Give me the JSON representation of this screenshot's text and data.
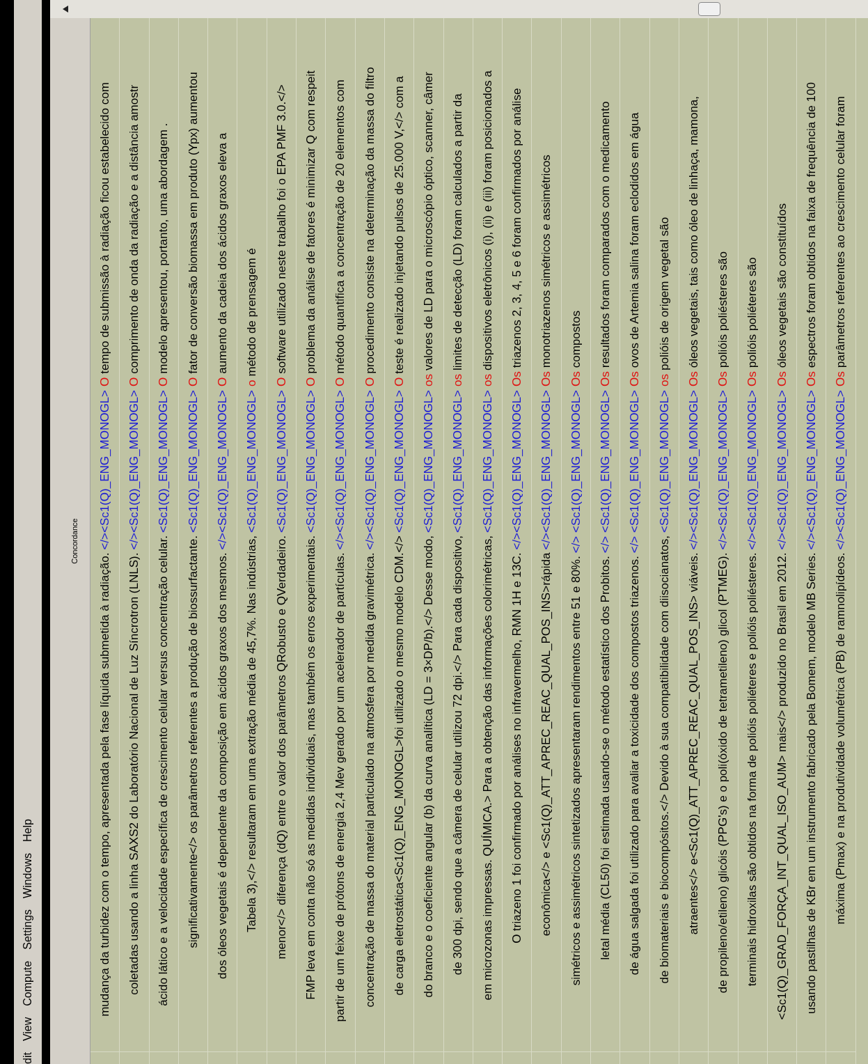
{
  "menu": [
    {
      "label": "dit"
    },
    {
      "label": "View"
    },
    {
      "label": "Compute"
    },
    {
      "label": "Settings"
    },
    {
      "label": "Windows"
    },
    {
      "label": "Help"
    }
  ],
  "panel": {
    "title": "Concordance"
  },
  "rows": [
    {
      "left": "mudança da turbidez com o tempo, apresentada pela fase líquida submetida à radiação.",
      "tag": "</><Sc1(Q)_ENG_MONOGL>",
      "node": "O",
      "right": "tempo de submissão à radiação ficou estabelecido com"
    },
    {
      "left": "coletadas usando a linha SAXS2 do Laboratório Nacional de Luz Síncrotron (LNLS).",
      "tag": "</><Sc1(Q)_ENG_MONOGL>",
      "node": "O",
      "right": "comprimento de onda da radiação e a distância amostr"
    },
    {
      "left": "ácido lático e a velocidade específica de crescimento celular versus concentração celular.",
      "tag": "<Sc1(Q)_ENG_MONOGL>",
      "node": "O",
      "right": "modelo apresentou, portanto, uma abordagem ."
    },
    {
      "left": "significativamente</> os parâmetros referentes a produção de biossurfactante.",
      "tag": "<Sc1(Q)_ENG_MONOGL>",
      "node": "O",
      "right": "fator de conversão biomassa em produto (Ypx) aumentou"
    },
    {
      "left": "dos óleos vegetais é dependente da composição em ácidos graxos dos mesmos.",
      "tag": "</><Sc1(Q)_ENG_MONOGL>",
      "node": "O",
      "right": "aumento da cadeia dos ácidos graxos eleva a"
    },
    {
      "left": "Tabela 3),</> resultaram em uma extração média de 45,7%. Nas indústrias,",
      "tag": "<Sc1(Q)_ENG_MONOGL>",
      "node": "o",
      "right": "método de prensagem é"
    },
    {
      "left": "menor</> diferença (dQ) entre o valor dos parâmetros QRobusto e QVerdadeiro.",
      "tag": "<Sc1(Q)_ENG_MONOGL>",
      "node": "O",
      "right": "software utilizado neste trabalho foi o EPA PMF 3.0.</>"
    },
    {
      "left": "FMP leva em conta não só as medidas individuais, mas também os erros experimentais.",
      "tag": "<Sc1(Q)_ENG_MONOGL>",
      "node": "O",
      "right": "problema da análise de fatores é minimizar Q com respeit"
    },
    {
      "left": "partir de um feixe de prótons de energia 2,4 Mev gerado por um acelerador de partículas.",
      "tag": "</><Sc1(Q)_ENG_MONOGL>",
      "node": "O",
      "right": "método quantifica a concentração de 20 elementos com"
    },
    {
      "left": "concentração de massa do material particulado na atmosfera por medida gravimétrica.",
      "tag": "</><Sc1(Q)_ENG_MONOGL>",
      "node": "O",
      "right": "procedimento consiste na determinação da massa do filtro"
    },
    {
      "left": "de carga eletrostática<Sc1(Q)_ENG_MONOGL>foi utilizado o mesmo modelo CDM.</>",
      "tag": "<Sc1(Q)_ENG_MONOGL>",
      "node": "O",
      "right": "teste é realizado injetando pulsos de 25.000 V,</> com a"
    },
    {
      "left": "do branco e o coeficiente angular (b) da curva analítica (LD = 3×DP/b).</> Desse modo,",
      "tag": "<Sc1(Q)_ENG_MONOGL>",
      "node": "os",
      "right": "valores de LD para o microscópio óptico, scanner, câmer"
    },
    {
      "left": "de 300 dpi, sendo que a câmera de celular utilizou 72 dpi.</> Para cada dispositivo,",
      "tag": "<Sc1(Q)_ENG_MONOGL>",
      "node": "os",
      "right": "limites de detecção (LD) foram calculados a partir da"
    },
    {
      "left": "em microzonas impressas. QUÍMICA.> Para a obtenção das informações colorimétricas,",
      "tag": "<Sc1(Q)_ENG_MONOGL>",
      "node": "os",
      "right": "dispositivos eletrônicos (i), (ii) e (iii) foram posicionados a"
    },
    {
      "left": "O triazeno 1 foi confirmado por análises no infravermelho, RMN 1H e 13C.",
      "tag": "</><Sc1(Q)_ENG_MONOGL>",
      "node": "Os",
      "right": "triazenos 2, 3, 4, 5 e 6 foram confirmados por análise"
    },
    {
      "left": "econômica</> e <Sc1(Q)_ATT_APREC_REAC_QUAL_POS_INS>rápida",
      "tag": "</><Sc1(Q)_ENG_MONOGL>",
      "node": "Os",
      "right": "monotriazenos simétricos e assimétricos"
    },
    {
      "left": "simétricos e assimétricos sintetizados apresentaram rendimentos entre 51 e 80%.",
      "tag": "</> <Sc1(Q)_ENG_MONOGL>",
      "node": "Os",
      "right": "compostos"
    },
    {
      "left": "letal média (CL50) foi estimada usando-se o método estatístico dos Probitos.",
      "tag": "</> <Sc1(Q)_ENG_MONOGL>",
      "node": "Os",
      "right": "resultados foram comparados com o medicamento"
    },
    {
      "left": "de água salgada foi utilizado para avaliar a toxicidade dos compostos triazenos.",
      "tag": "</> <Sc1(Q)_ENG_MONOGL>",
      "node": "Os",
      "right": "ovos de Artemia salina foram eclodidos em água"
    },
    {
      "left": "de biomateriais e biocompósitos.</> Devido à sua compatibilidade com diisocianatos,",
      "tag": "<Sc1(Q)_ENG_MONOGL>",
      "node": "os",
      "right": "polióis de origem vegetal são"
    },
    {
      "left": "atraentes</> e<Sc1(Q)_ATT_APREC_REAC_QUAL_POS_INS> viáveis.",
      "tag": "</><Sc1(Q)_ENG_MONOGL>",
      "node": "Os",
      "right": "óleos vegetais, tais como óleo de linhaça, mamona,"
    },
    {
      "left": "de propileno/etileno) glicóis (PPG's) e o poli(óxido de tetrametileno) glicol (PTMEG).",
      "tag": "</><Sc1(Q)_ENG_MONOGL>",
      "node": "Os",
      "right": "polióis poliésteres são"
    },
    {
      "left": "terminais hidroxilas são obtidos na forma de polióis poliéteres e polióis poliésteres.",
      "tag": "</><Sc1(Q)_ENG_MONOGL>",
      "node": "Os",
      "right": "polióis poliéteres são"
    },
    {
      "left": "<Sc1(Q)_GRAD_FORÇA_INT_QUAL_ISO_AUM> mais</> produzido no Brasil em 2012.",
      "tag": "</><Sc1(Q)_ENG_MONOGL>",
      "node": "Os",
      "right": "óleos vegetais são constituídos"
    },
    {
      "left": "usando pastilhas de KBr em um instrumento fabricado pela Bomem, modelo MB Series.",
      "tag": "</><Sc1(Q)_ENG_MONOGL>",
      "node": "Os",
      "right": "espectros foram obtidos na faixa de frequência de 100"
    },
    {
      "left": "máxima (Pmax) e na produtividade volumétrica (PB) de ramnolipídeos.",
      "tag": "</><Sc1(Q)_ENG_MONOGL>",
      "node": "Os",
      "right": "parâmetros referentes ao crescimento celular foram"
    }
  ]
}
